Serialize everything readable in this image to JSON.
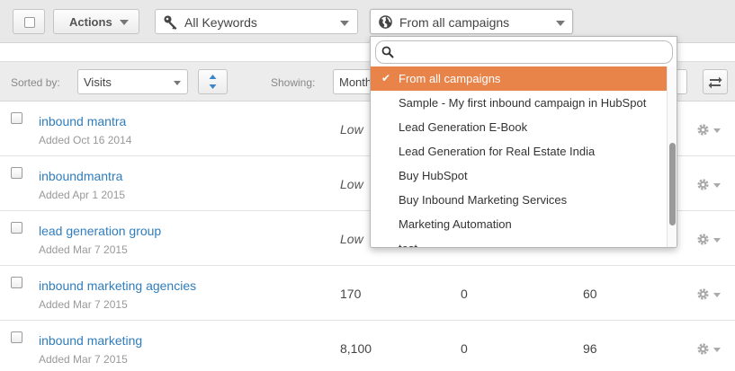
{
  "toolbar": {
    "actions_label": "Actions",
    "keywords_select": {
      "value": "All Keywords",
      "icon": "key-icon"
    },
    "campaigns_select": {
      "value": "From all campaigns",
      "icon": "globe-icon"
    }
  },
  "sortbar": {
    "sorted_by_label": "Sorted by:",
    "sort_value": "Visits",
    "showing_label": "Showing:",
    "showing_value": "Month"
  },
  "rows": [
    {
      "keyword": "inbound mantra",
      "added": "Added Oct 16 2014",
      "volume": "Low"
    },
    {
      "keyword": "inboundmantra",
      "added": "Added Apr 1 2015",
      "volume": "Low"
    },
    {
      "keyword": "lead generation group",
      "added": "Added Mar 7 2015",
      "volume": "Low"
    },
    {
      "keyword": "inbound marketing agencies",
      "added": "Added Mar 7 2015",
      "volume": "170",
      "col2": "0",
      "col3": "60"
    },
    {
      "keyword": "inbound marketing",
      "added": "Added Mar 7 2015",
      "volume": "8,100",
      "col2": "0",
      "col3": "96"
    }
  ],
  "dropdown": {
    "search_value": "",
    "selected_index": 0,
    "items": [
      "From all campaigns",
      "Sample - My first inbound campaign in HubSpot",
      "Lead Generation E-Book",
      "Lead Generation for Real Estate India",
      "Buy HubSpot",
      "Buy Inbound Marketing Services",
      "Marketing Automation",
      "test"
    ]
  },
  "colors": {
    "accent": "#e8844a",
    "link": "#2f7dbd",
    "muted": "#999999"
  }
}
